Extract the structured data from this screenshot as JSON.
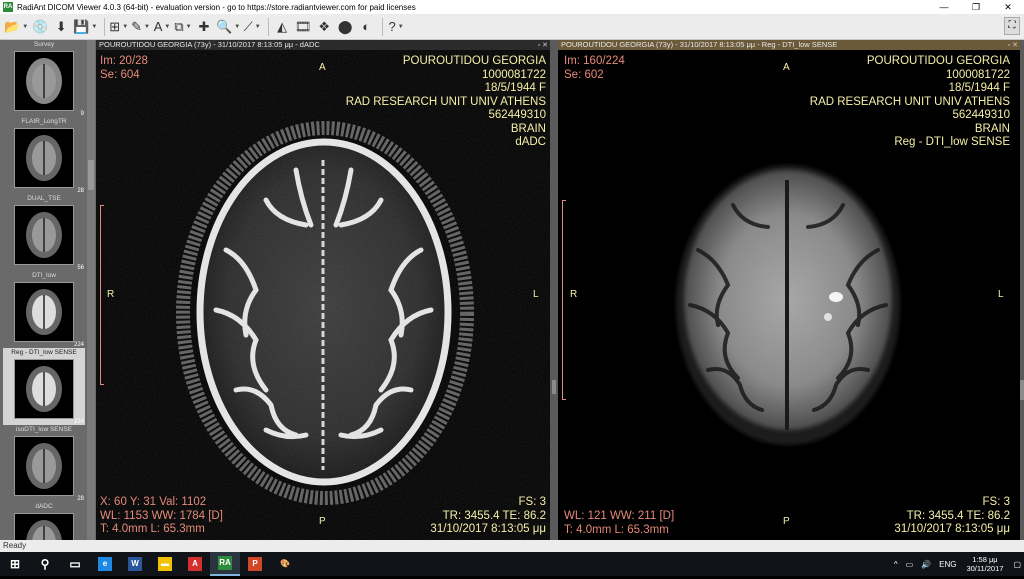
{
  "window": {
    "title": "RadiAnt DICOM Viewer 4.0.3 (64-bit) - evaluation version - go to https://store.radiantviewer.com for paid licenses",
    "app_icon_text": "RA",
    "minimize": "—",
    "restore": "❐",
    "close": "✕"
  },
  "toolbar": {
    "buttons": [
      {
        "name": "open-folder-icon",
        "glyph": "📂",
        "dropdown": true
      },
      {
        "name": "cd-icon",
        "glyph": "💿",
        "dropdown": false
      },
      {
        "name": "download-icon",
        "glyph": "⬇",
        "dropdown": false
      },
      {
        "name": "save-icon",
        "glyph": "💾",
        "dropdown": true
      },
      {
        "name": "layout-grid-icon",
        "glyph": "⊞",
        "dropdown": true
      },
      {
        "name": "pen-icon",
        "glyph": "✎",
        "dropdown": true
      },
      {
        "name": "text-icon",
        "glyph": "A",
        "dropdown": true
      },
      {
        "name": "sync-icon",
        "glyph": "⧉",
        "dropdown": true
      },
      {
        "name": "crosshair-icon",
        "glyph": "✚",
        "dropdown": false
      },
      {
        "name": "probe-icon",
        "glyph": "🔍",
        "dropdown": true
      },
      {
        "name": "ruler-icon",
        "glyph": "⟋",
        "dropdown": true
      },
      {
        "name": "mpr-icon",
        "glyph": "◭",
        "dropdown": false
      },
      {
        "name": "film-icon",
        "glyph": "🎞",
        "dropdown": false
      },
      {
        "name": "reconstruction-icon",
        "glyph": "❖",
        "dropdown": false
      },
      {
        "name": "3d-icon",
        "glyph": "⬤",
        "dropdown": false
      },
      {
        "name": "fusion-icon",
        "glyph": "◐",
        "dropdown": false
      },
      {
        "name": "help-icon",
        "glyph": "?",
        "dropdown": true
      }
    ],
    "fullscreen_glyph": "⛶"
  },
  "series": [
    {
      "label": "Survey",
      "count": "9",
      "selected": false
    },
    {
      "label": "FLAIR_LongTR",
      "count": "28",
      "selected": false
    },
    {
      "label": "DUAL_TSE",
      "count": "56",
      "selected": false
    },
    {
      "label": "DTI_low",
      "count": "224",
      "selected": false
    },
    {
      "label": "Reg - DTI_low SENSE",
      "count": "224",
      "selected": true
    },
    {
      "label": "isoDTI_low SENSE",
      "count": "28",
      "selected": false
    },
    {
      "label": "dADC",
      "count": "",
      "selected": false
    }
  ],
  "left_view": {
    "header": "POUROUTIDOU GEORGIA (73y) - 31/10/2017 8:13:05 μμ - dADC",
    "image": "Im: 20/28",
    "series": "Se: 604",
    "patient": "POUROUTIDOU GEORGIA",
    "patient_id": "1000081722",
    "dob": "18/5/1944 F",
    "institution": "RAD RESEARCH UNIT UNIV ATHENS",
    "accession": "562449310",
    "body_part": "BRAIN",
    "series_desc": "dADC",
    "probe": "X: 60 Y: 31 Val: 1102",
    "window": "WL: 1153 WW: 1784 [D]",
    "thickness": "T: 4.0mm L: 65.3mm",
    "fs": "FS: 3",
    "tr_te": "TR: 3455.4 TE: 86.2",
    "datetime": "31/10/2017 8:13:05 μμ",
    "orient_top": "A",
    "orient_bottom": "P",
    "orient_left": "R",
    "orient_right": "L"
  },
  "right_view": {
    "header": "POUROUTIDOU GEORGIA (73y) - 31/10/2017 8:13:05 μμ - Reg - DTI_low SENSE",
    "image": "Im: 160/224",
    "series": "Se: 602",
    "patient": "POUROUTIDOU GEORGIA",
    "patient_id": "1000081722",
    "dob": "18/5/1944 F",
    "institution": "RAD RESEARCH UNIT UNIV ATHENS",
    "accession": "562449310",
    "body_part": "BRAIN",
    "series_desc": "Reg - DTI_low SENSE",
    "window": "WL: 121 WW: 211 [D]",
    "thickness": "T: 4.0mm L: 65.3mm",
    "fs": "FS: 3",
    "tr_te": "TR: 3455.4 TE: 86.2",
    "datetime": "31/10/2017 8:13:05 μμ",
    "orient_top": "A",
    "orient_bottom": "P",
    "orient_left": "R",
    "orient_right": "L"
  },
  "status": "Ready",
  "taskbar": {
    "apps": [
      {
        "name": "start-windows-icon",
        "glyph": "⊞",
        "color": "#ffffff",
        "active": false
      },
      {
        "name": "search-icon",
        "glyph": "⚲",
        "color": "#ffffff",
        "active": false
      },
      {
        "name": "task-view-icon",
        "glyph": "▭",
        "color": "#ffffff",
        "active": false
      },
      {
        "name": "edge-icon",
        "glyph": "e",
        "color": "#1e88e5",
        "active": false
      },
      {
        "name": "word-icon",
        "glyph": "W",
        "color": "#2b579a",
        "active": false
      },
      {
        "name": "file-explorer-icon",
        "glyph": "▬",
        "color": "#f2c200",
        "active": false
      },
      {
        "name": "acrobat-icon",
        "glyph": "A",
        "color": "#d32f2f",
        "active": false
      },
      {
        "name": "radiant-icon",
        "glyph": "RA",
        "color": "#2e8b3e",
        "active": true
      },
      {
        "name": "powerpoint-icon",
        "glyph": "P",
        "color": "#d24726",
        "active": false
      },
      {
        "name": "paint-icon",
        "glyph": "🎨",
        "color": "#ffffff",
        "active": false
      }
    ],
    "tray_caret": "^",
    "lang": "ENG",
    "time": "1:58 μμ",
    "date": "30/11/2017"
  }
}
